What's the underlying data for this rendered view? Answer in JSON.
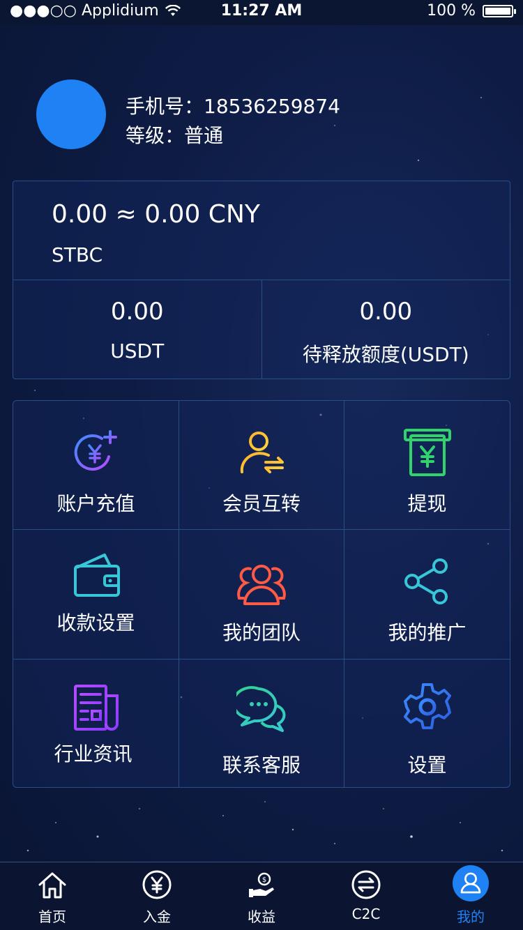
{
  "status_bar": {
    "carrier": "●●●○○ Applidium",
    "time": "11:27 AM",
    "battery": "100 %"
  },
  "profile": {
    "phone_line": "手机号：18536259874",
    "level_line": "等级：普通"
  },
  "balance": {
    "main": "0.00 ≈ 0.00 CNY",
    "currency": "STBC",
    "usdt_value": "0.00",
    "usdt_label": "USDT",
    "pending_value": "0.00",
    "pending_label": "待释放额度(USDT)"
  },
  "menu": {
    "items": [
      {
        "label": "账户充值",
        "icon": "recharge-yen-plus-icon"
      },
      {
        "label": "会员互转",
        "icon": "user-transfer-icon"
      },
      {
        "label": "提现",
        "icon": "withdraw-yen-icon"
      },
      {
        "label": "收款设置",
        "icon": "wallet-icon"
      },
      {
        "label": "我的团队",
        "icon": "team-icon"
      },
      {
        "label": "我的推广",
        "icon": "share-icon"
      },
      {
        "label": "行业资讯",
        "icon": "newspaper-icon"
      },
      {
        "label": "联系客服",
        "icon": "chat-bubbles-icon"
      },
      {
        "label": "设置",
        "icon": "gear-icon"
      }
    ]
  },
  "tab_bar": {
    "tabs": [
      {
        "label": "首页",
        "icon": "home-icon"
      },
      {
        "label": "入金",
        "icon": "yen-circle-icon"
      },
      {
        "label": "收益",
        "icon": "hand-coin-icon"
      },
      {
        "label": "C2C",
        "icon": "exchange-icon"
      },
      {
        "label": "我的",
        "icon": "user-icon",
        "active": true
      }
    ]
  },
  "colors": {
    "background": "#0e1c45",
    "accent": "#1e82f4",
    "border": "#2a4f85"
  }
}
